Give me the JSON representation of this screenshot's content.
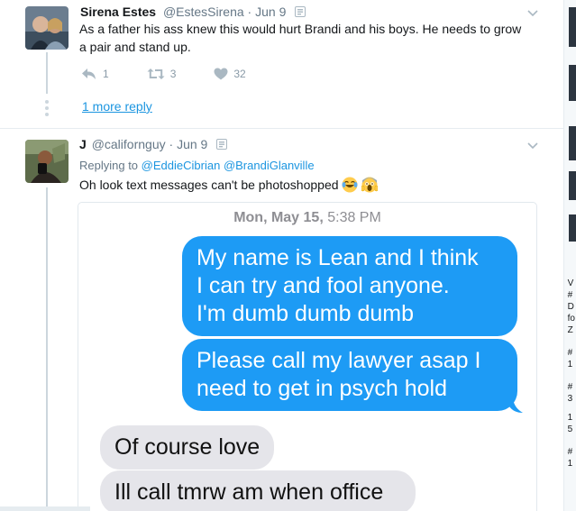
{
  "tweet1": {
    "name": "Sirena Estes",
    "handle": "@EstesSirena",
    "dot": "·",
    "date": "Jun 9",
    "text_line1": "As a father his ass knew this would hurt Brandi and his boys. He needs to grow",
    "text_line2": "a pair and stand up.",
    "actions": {
      "reply_count": "1",
      "retweet_count": "3",
      "like_count": "32"
    },
    "more_reply": "1 more reply"
  },
  "tweet2": {
    "name": "J",
    "handle": "@californguy",
    "dot": "·",
    "date": "Jun 9",
    "replying_prefix": "Replying to",
    "replying_1": "@EddieCibrian",
    "replying_2": "@BrandiGlanville",
    "text": "Oh look text messages can't be photoshopped",
    "emojis": [
      "face-with-tears-of-joy",
      "face-screaming-in-fear"
    ]
  },
  "media": {
    "date_day": "Mon, May 15,",
    "date_time": "5:38 PM",
    "bubbles": [
      {
        "dir": "out",
        "lines": [
          "My name is Lean and I think",
          "I can try and fool anyone.",
          "I'm dumb dumb dumb"
        ]
      },
      {
        "dir": "out",
        "lines": [
          "Please call my lawyer asap I",
          "need to get in psych hold"
        ]
      },
      {
        "dir": "in",
        "lines": [
          "Of course love"
        ]
      },
      {
        "dir": "in",
        "lines": [
          "Ill call tmrw am when office"
        ]
      }
    ]
  },
  "gutter": {
    "letters": [
      "V",
      "#",
      "D",
      "fo",
      "Z",
      "#",
      "1",
      "#",
      "3",
      "1",
      "5",
      "#",
      "1"
    ]
  },
  "colors": {
    "link": "#1b95e0",
    "bubble_out": "#1d9bf5",
    "bubble_in": "#e5e5ea",
    "muted": "#657786"
  }
}
